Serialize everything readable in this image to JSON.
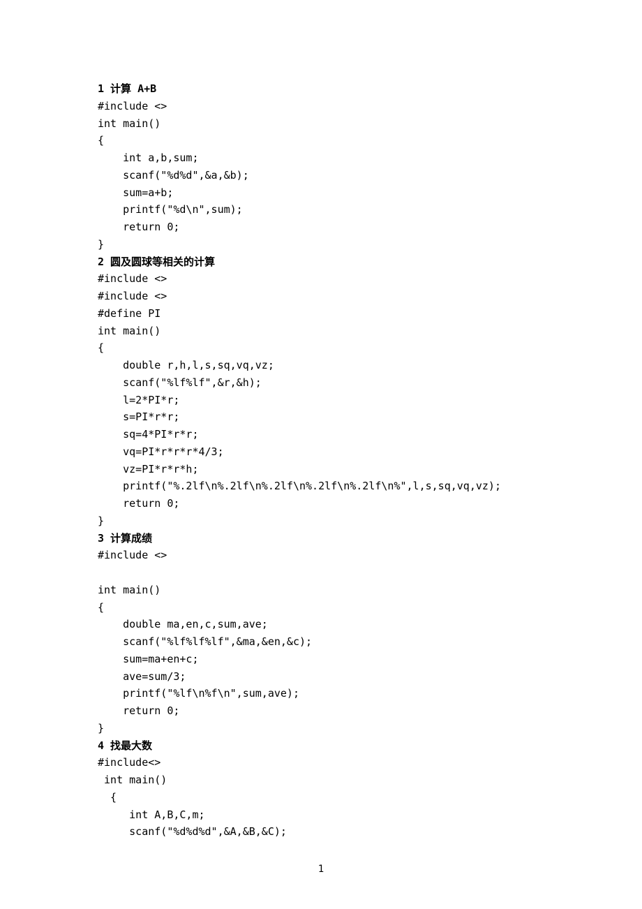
{
  "sections": [
    {
      "heading": "1 计算 A+B",
      "lines": [
        "#include <>",
        "int main()",
        "{",
        "    int a,b,sum;",
        "    scanf(\"%d%d\",&a,&b);",
        "    sum=a+b;",
        "    printf(\"%d\\n\",sum);",
        "    return 0;",
        "}"
      ]
    },
    {
      "heading": "2 圆及圆球等相关的计算",
      "lines": [
        "#include <>",
        "#include <>",
        "#define PI",
        "int main()",
        "{",
        "    double r,h,l,s,sq,vq,vz;",
        "    scanf(\"%lf%lf\",&r,&h);",
        "    l=2*PI*r;",
        "    s=PI*r*r;",
        "    sq=4*PI*r*r;",
        "    vq=PI*r*r*r*4/3;",
        "    vz=PI*r*r*h;",
        "    printf(\"%.2lf\\n%.2lf\\n%.2lf\\n%.2lf\\n%.2lf\\n%\",l,s,sq,vq,vz);",
        "    return 0;",
        "}"
      ]
    },
    {
      "heading": "3 计算成绩",
      "lines": [
        "#include <>",
        "",
        "int main()",
        "{",
        "    double ma,en,c,sum,ave;",
        "    scanf(\"%lf%lf%lf\",&ma,&en,&c);",
        "    sum=ma+en+c;",
        "    ave=sum/3;",
        "    printf(\"%lf\\n%f\\n\",sum,ave);",
        "    return 0;",
        "}"
      ]
    },
    {
      "heading": "4 找最大数",
      "lines": [
        "#include<>",
        " int main()",
        "  {",
        "     int A,B,C,m;",
        "     scanf(\"%d%d%d\",&A,&B,&C);"
      ]
    }
  ],
  "page_number": "1"
}
